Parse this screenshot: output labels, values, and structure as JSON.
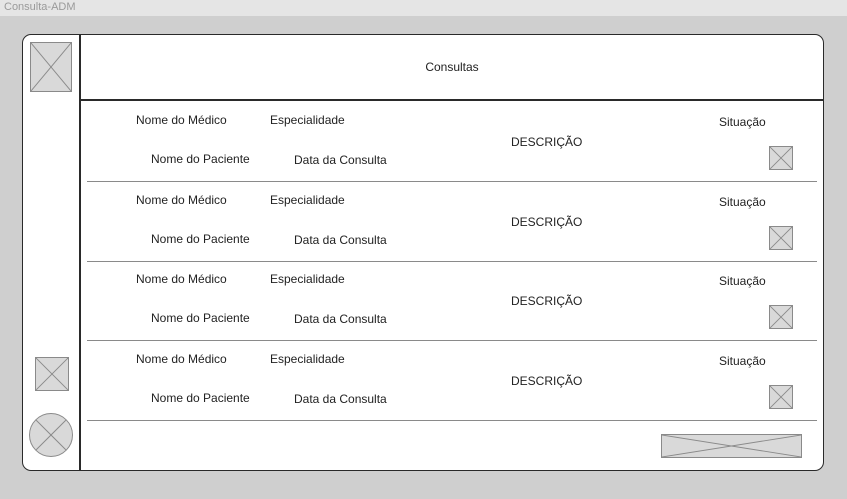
{
  "frame": {
    "label": "Consulta-ADM"
  },
  "header": {
    "title": "Consultas"
  },
  "sidebar": {
    "logo_icon": "image-placeholder-icon",
    "action_icon": "image-placeholder-icon",
    "avatar_icon": "avatar-placeholder-icon"
  },
  "consultas": [
    {
      "medico": "Nome do Médico",
      "especialidade": "Especialidade",
      "paciente": "Nome do Paciente",
      "data": "Data da Consulta",
      "descricao": "DESCRIÇÃO",
      "situacao": "Situação"
    },
    {
      "medico": "Nome do Médico",
      "especialidade": "Especialidade",
      "paciente": "Nome do Paciente",
      "data": "Data da Consulta",
      "descricao": "DESCRIÇÃO",
      "situacao": "Situação"
    },
    {
      "medico": "Nome do Médico",
      "especialidade": "Especialidade",
      "paciente": "Nome do Paciente",
      "data": "Data da Consulta",
      "descricao": "DESCRIÇÃO",
      "situacao": "Situação"
    },
    {
      "medico": "Nome do Médico",
      "especialidade": "Especialidade",
      "paciente": "Nome do Paciente",
      "data": "Data da Consulta",
      "descricao": "DESCRIÇÃO",
      "situacao": "Situação"
    }
  ],
  "colors": {
    "placeholder_fill": "#d9d9d9",
    "placeholder_stroke": "#8a8a8a",
    "frame_bg": "#cfcfcf",
    "border": "#2a2a2a"
  }
}
